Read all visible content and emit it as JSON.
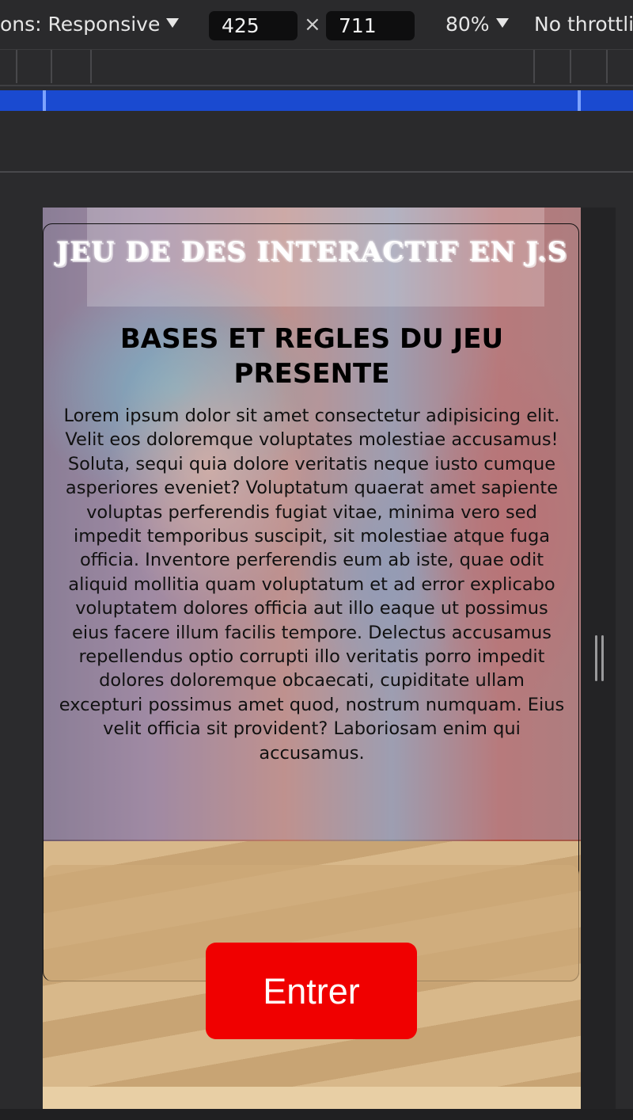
{
  "toolbar": {
    "dimensions_label": "ons: Responsive",
    "width_value": "425",
    "times_symbol": "×",
    "height_value": "711",
    "zoom_label": "80%",
    "throttle_label": "No throttli"
  },
  "page": {
    "title": "JEU DE DES INTERACTIF EN J.S",
    "rules_heading": "BASES ET REGLES DU JEU PRESENTE",
    "rules_body": "Lorem ipsum dolor sit amet consectetur adipisicing elit. Velit eos doloremque voluptates molestiae accusamus! Soluta, sequi quia dolore veritatis neque iusto cumque asperiores eveniet? Voluptatum quaerat amet sapiente voluptas perferendis fugiat vitae, minima vero sed impedit temporibus suscipit, sit molestiae atque fuga officia. Inventore perferendis eum ab iste, quae odit aliquid mollitia quam voluptatum et ad error explicabo voluptatem dolores officia aut illo eaque ut possimus eius facere illum facilis tempore. Delectus accusamus repellendus optio corrupti illo veritatis porro impedit dolores doloremque obcaecati, cupiditate ullam excepturi possimus amet quod, nostrum numquam. Eius velit officia sit provident? Laboriosam enim qui accusamus.",
    "enter_button": "Entrer"
  },
  "colors": {
    "device_toolbar_bg": "#2a2a2c",
    "ruler_accent": "#1a4ad0",
    "enter_button": "#f00000"
  },
  "icons": {
    "dimensions_dropdown": "caret-down-icon",
    "zoom_dropdown": "caret-down-icon",
    "viewport_resize": "resize-handle-icon"
  }
}
